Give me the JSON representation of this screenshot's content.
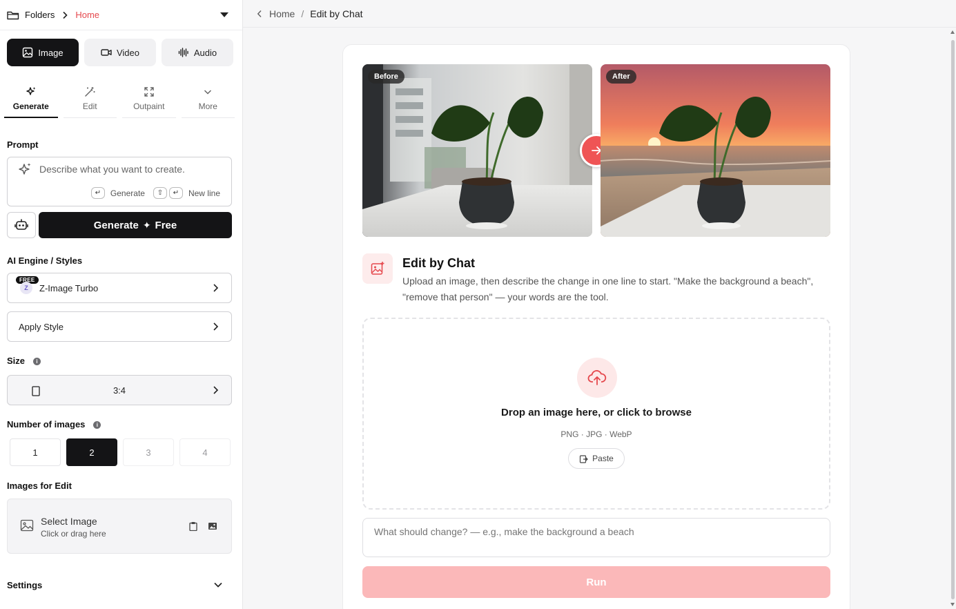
{
  "sidebar": {
    "breadcrumb": {
      "folders": "Folders",
      "home": "Home"
    },
    "media_tabs": [
      {
        "label": "Image",
        "icon": "image-icon",
        "active": true
      },
      {
        "label": "Video",
        "icon": "video-icon",
        "active": false
      },
      {
        "label": "Audio",
        "icon": "audio-wave-icon",
        "active": false
      }
    ],
    "mode_tabs": [
      {
        "label": "Generate",
        "icon": "sparkle-icon",
        "active": true
      },
      {
        "label": "Edit",
        "icon": "magic-wand-icon",
        "active": false
      },
      {
        "label": "Outpaint",
        "icon": "expand-icon",
        "active": false
      },
      {
        "label": "More",
        "icon": "chevron-down-icon",
        "active": false
      }
    ],
    "prompt": {
      "label": "Prompt",
      "placeholder": "Describe what you want to create.",
      "hint_generate": "Generate",
      "hint_newline": "New line"
    },
    "generate_button": {
      "label": "Generate",
      "cost": "Free"
    },
    "engine": {
      "label": "AI Engine / Styles",
      "badge": "FREE",
      "model": "Z-Image Turbo",
      "apply_style": "Apply Style"
    },
    "size": {
      "label": "Size",
      "value": "3:4"
    },
    "number_of_images": {
      "label": "Number of images",
      "options": [
        "1",
        "2",
        "3",
        "4"
      ],
      "selected": "2"
    },
    "images_for_edit": {
      "label": "Images for Edit",
      "title": "Select Image",
      "subtitle": "Click or drag here"
    },
    "settings": {
      "label": "Settings"
    }
  },
  "topbar": {
    "home": "Home",
    "separator": "/",
    "current": "Edit by Chat"
  },
  "main": {
    "before_label": "Before",
    "after_label": "After",
    "feature": {
      "title": "Edit by Chat",
      "description": "Upload an image, then describe the change in one line to start. \"Make the background a beach\", \"remove that person\" — your words are the tool."
    },
    "dropzone": {
      "title": "Drop an image here, or click to browse",
      "types": "PNG · JPG · WebP",
      "paste_label": "Paste"
    },
    "change_input_placeholder": "What should change? — e.g., make the background a beach",
    "run_label": "Run"
  },
  "colors": {
    "accent": "#e5484d",
    "run_disabled": "#fbb8b9",
    "dark": "#141416"
  }
}
